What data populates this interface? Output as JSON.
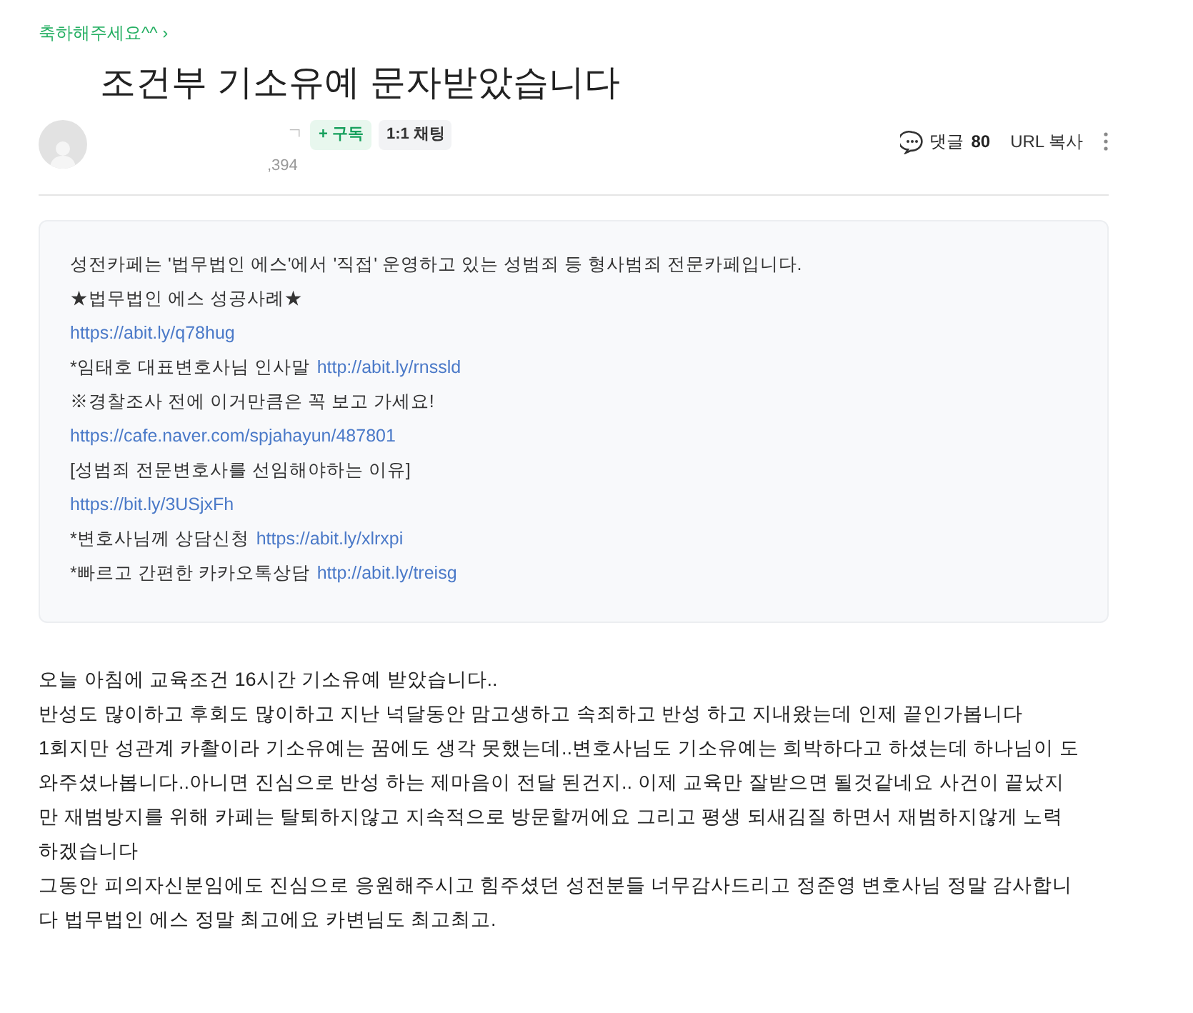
{
  "breadcrumb": "축하해주세요^^ ›",
  "title": "조건부 기소유예 문자받았습니다",
  "author": {
    "name": "ㄱ",
    "subscribe": "+ 구독",
    "chat": "1:1 채팅",
    "count": ",394"
  },
  "actions": {
    "comments_label": "댓글",
    "comments_count": "80",
    "copy_url": "URL 복사"
  },
  "notice_lines": [
    {
      "text": "성전카페는 '법무법인 에스'에서 '직접' 운영하고 있는 성범죄 등 형사범죄 전문카페입니다."
    },
    {
      "text": "★법무법인 에스 성공사례★"
    },
    {
      "link": "https://abit.ly/q78hug"
    },
    {
      "text": "*임태호 대표변호사님 인사말",
      "link": "http://abit.ly/rnssld"
    },
    {
      "text": "※경찰조사 전에 이거만큼은 꼭 보고 가세요!"
    },
    {
      "link": "https://cafe.naver.com/spjahayun/487801"
    },
    {
      "text": "[성범죄 전문변호사를 선임해야하는 이유]"
    },
    {
      "link": "https://bit.ly/3USjxFh"
    },
    {
      "text": "*변호사님께 상담신청",
      "link": "https://abit.ly/xlrxpi"
    },
    {
      "text": "*빠르고 간편한 카카오톡상담",
      "link": "http://abit.ly/treisg"
    }
  ],
  "body_lines": [
    "오늘 아침에 교육조건 16시간 기소유예 받았습니다..",
    "반성도 많이하고 후회도 많이하고 지난 넉달동안 맘고생하고 속죄하고 반성 하고 지내왔는데 인제 끝인가봅니다",
    "1회지만 성관계 카촬이라 기소유예는 꿈에도 생각 못했는데..변호사님도 기소유예는 희박하다고 하셨는데 하나님이 도",
    "와주셨나봅니다..아니면 진심으로 반성 하는 제마음이 전달 된건지.. 이제 교육만 잘받으면 될것같네요 사건이 끝났지",
    "만 재범방지를 위해 카페는 탈퇴하지않고 지속적으로 방문할꺼에요 그리고 평생 되새김질 하면서 재범하지않게 노력",
    "하겠습니다",
    "그동안 피의자신분임에도 진심으로 응원해주시고 힘주셨던 성전분들 너무감사드리고 정준영 변호사님 정말 감사합니",
    "다 법무법인 에스 정말 최고에요 카변님도 최고최고."
  ]
}
